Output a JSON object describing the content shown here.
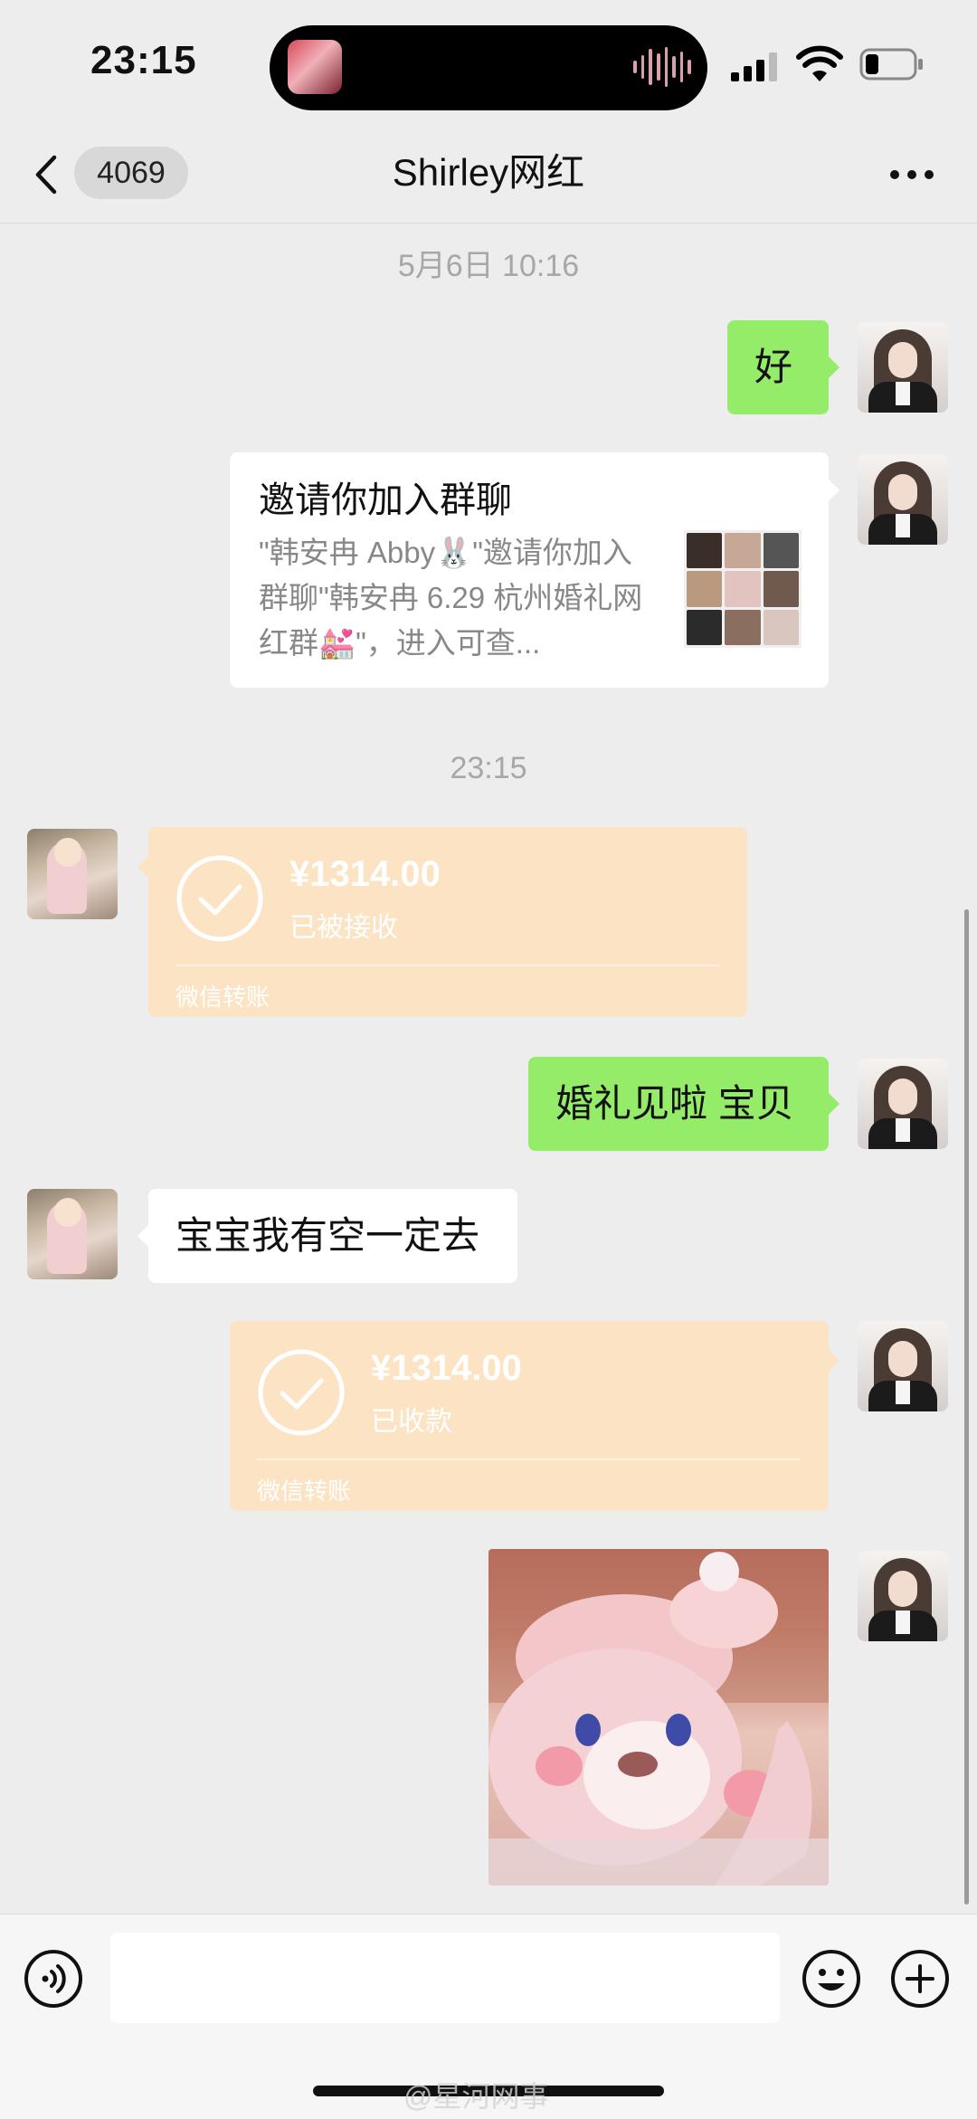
{
  "status_bar": {
    "time": "23:15"
  },
  "nav": {
    "back_icon": "chevron-left-icon",
    "unread_count": "4069",
    "title": "Shirley网红",
    "more_icon": "ellipsis-icon"
  },
  "messages": {
    "timestamp_1": "5月6日 10:16",
    "msg_1_text": "好",
    "invite": {
      "title": "邀请你加入群聊",
      "description": "\"韩安冉 Abby🐰\"邀请你加入群聊\"韩安冉 6.29 杭州婚礼网红群💒\"，进入可查..."
    },
    "timestamp_2": "23:15",
    "transfer_1": {
      "amount": "¥1314.00",
      "status": "已被接收",
      "footer": "微信转账"
    },
    "msg_2_text": "婚礼见啦 宝贝",
    "msg_3_text": "宝宝我有空一定去",
    "transfer_2": {
      "amount": "¥1314.00",
      "status": "已收款",
      "footer": "微信转账"
    },
    "sticker": "pink-bunny-sticker"
  },
  "input_bar": {
    "voice_icon": "voice-icon",
    "emoji_icon": "smiley-icon",
    "plus_icon": "plus-icon"
  },
  "watermark": "@星河网事",
  "colors": {
    "background": "#EDEDED",
    "bubble_green": "#95EC69",
    "transfer_bg": "#FCE3C4"
  }
}
